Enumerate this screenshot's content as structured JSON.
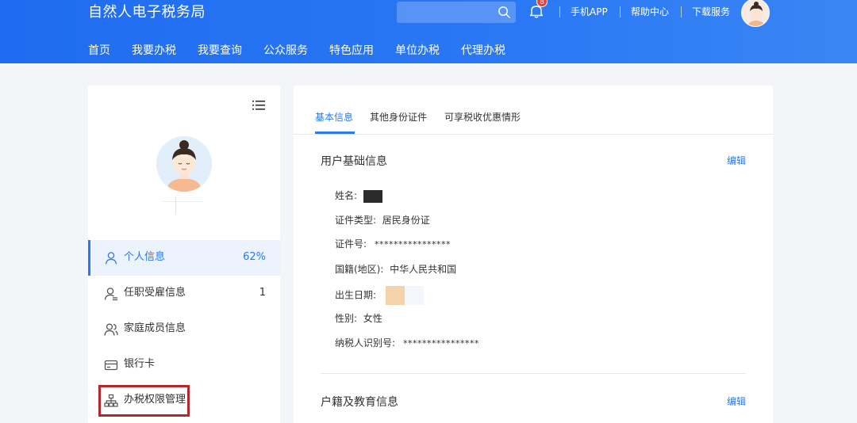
{
  "header": {
    "brand": "自然人电子税务局",
    "search": {
      "value": "",
      "placeholder": ""
    },
    "notification_count": "8",
    "links": [
      "手机APP",
      "帮助中心",
      "下载服务"
    ],
    "accent": "#2a78f4"
  },
  "nav": [
    "首页",
    "我要办税",
    "我要查询",
    "公众服务",
    "特色应用",
    "单位办税",
    "代理办税"
  ],
  "sidebar": {
    "items": [
      {
        "label": "个人信息",
        "count": "62%",
        "icon": "user-icon",
        "active": true
      },
      {
        "label": "任职受雇信息",
        "count": "1",
        "icon": "user-employment-icon"
      },
      {
        "label": "家庭成员信息",
        "count": "",
        "icon": "family-icon"
      },
      {
        "label": "银行卡",
        "count": "",
        "icon": "bank-card-icon"
      },
      {
        "label": "办税权限管理",
        "count": "",
        "icon": "org-tree-icon",
        "highlighted": true
      }
    ]
  },
  "tabs": [
    "基本信息",
    "其他身份证件",
    "可享税收优惠情形"
  ],
  "basic": {
    "title": "用户基础信息",
    "edit": "编辑",
    "fields": [
      {
        "label": "姓名:",
        "value": ""
      },
      {
        "label": "证件类型:",
        "value": "居民身份证"
      },
      {
        "label": "证件号:",
        "value": "****************"
      },
      {
        "label": "国籍(地区):",
        "value": "中华人民共和国"
      },
      {
        "label": "出生日期:",
        "value": ""
      },
      {
        "label": "性别:",
        "value": "女性"
      },
      {
        "label": "纳税人识别号:",
        "value": "****************"
      }
    ]
  },
  "household": {
    "title": "户籍及教育信息",
    "edit": "编辑"
  }
}
